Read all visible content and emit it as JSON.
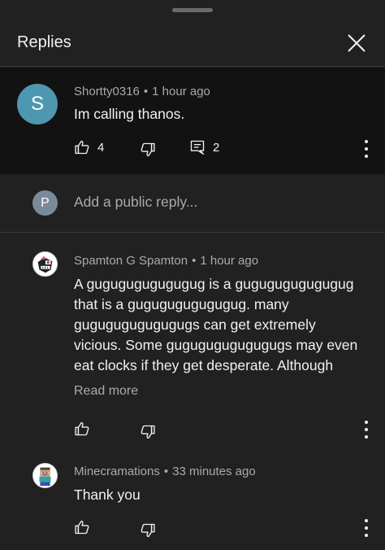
{
  "header": {
    "title": "Replies"
  },
  "main_comment": {
    "avatar_letter": "S",
    "author": "Shortty0316",
    "time": "1 hour ago",
    "text": "Im calling thanos.",
    "likes": "4",
    "replies": "2"
  },
  "reply_box": {
    "avatar_letter": "P",
    "placeholder": "Add a public reply..."
  },
  "replies": [
    {
      "author": "Spamton G Spamton",
      "time": "1 hour ago",
      "text_lines": [
        "A gugugugugugugug is a gugugugugugugug",
        "that is a gugugugugugugug. many",
        "gugugugugugugugs can get extremely",
        "vicious. Some gugugugugugugugs may even",
        "eat clocks if they get desperate. Although"
      ],
      "read_more": "Read more"
    },
    {
      "author": "Minecramations",
      "time": "33 minutes ago",
      "text": "Thank you"
    }
  ],
  "separator": "•",
  "colors": {
    "background": "#212121",
    "highlight": "#121212",
    "avatar_s": "#4e97b1",
    "avatar_p": "#7b8a99",
    "muted_text": "#aaaaaa"
  }
}
